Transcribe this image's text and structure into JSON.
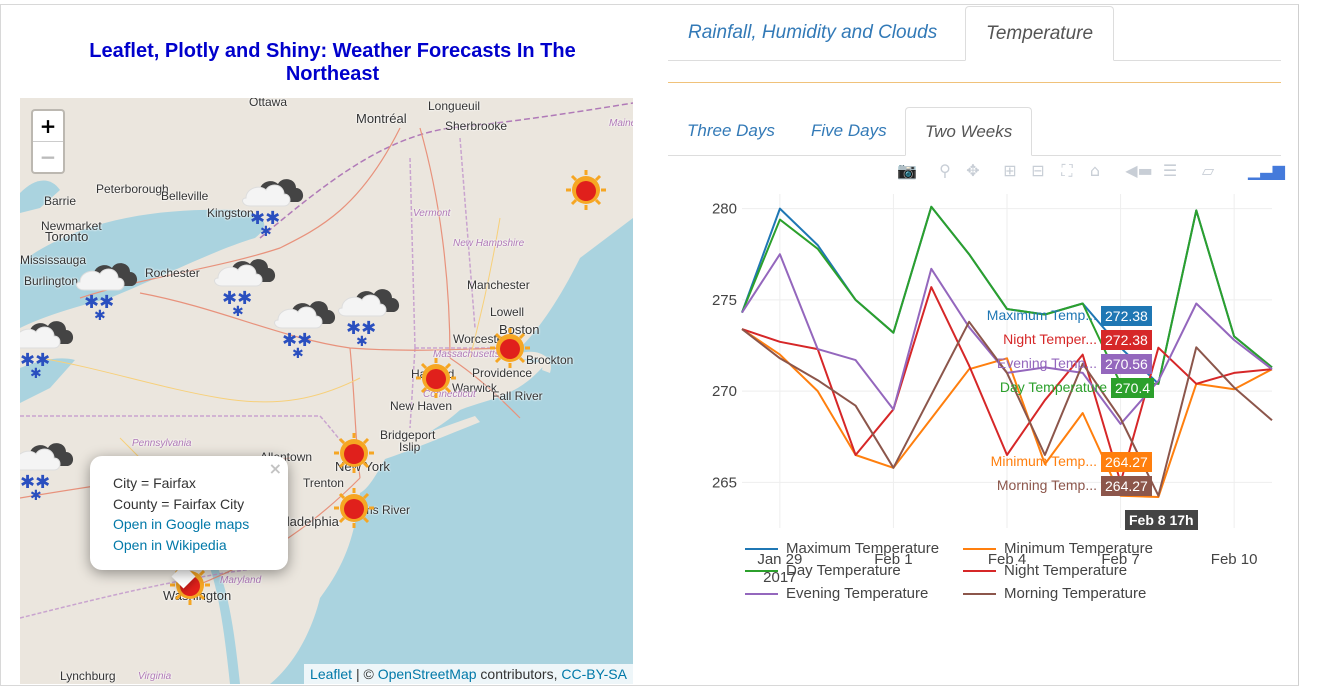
{
  "page": {
    "title": "Leaflet, Plotly and Shiny: Weather Forecasts In The Northeast"
  },
  "map": {
    "zoom_in": "+",
    "zoom_out": "−",
    "labels": [
      {
        "text": "Ottawa",
        "cls": "big"
      },
      {
        "text": "Longueuil",
        "cls": ""
      },
      {
        "text": "Montréal",
        "cls": "big"
      },
      {
        "text": "Sherbrooke",
        "cls": ""
      },
      {
        "text": "Maine",
        "cls": "state"
      },
      {
        "text": "Barrie",
        "cls": ""
      },
      {
        "text": "Peterborough",
        "cls": ""
      },
      {
        "text": "Belleville",
        "cls": ""
      },
      {
        "text": "Kingston",
        "cls": ""
      },
      {
        "text": "Vermont",
        "cls": "state"
      },
      {
        "text": "Newmarket",
        "cls": ""
      },
      {
        "text": "Toronto",
        "cls": "big"
      },
      {
        "text": "New Hampshire",
        "cls": "state"
      },
      {
        "text": "Mississauga",
        "cls": ""
      },
      {
        "text": "Rochester",
        "cls": ""
      },
      {
        "text": "Burlington",
        "cls": ""
      },
      {
        "text": "Manchester",
        "cls": ""
      },
      {
        "text": "Lowell",
        "cls": ""
      },
      {
        "text": "Worcester",
        "cls": ""
      },
      {
        "text": "Boston",
        "cls": "big"
      },
      {
        "text": "Massachusetts",
        "cls": "state"
      },
      {
        "text": "Brockton",
        "cls": ""
      },
      {
        "text": "Hartford",
        "cls": ""
      },
      {
        "text": "Providence",
        "cls": ""
      },
      {
        "text": "Warwick",
        "cls": ""
      },
      {
        "text": "Connecticut",
        "cls": "state"
      },
      {
        "text": "Fall River",
        "cls": ""
      },
      {
        "text": "New Haven",
        "cls": ""
      },
      {
        "text": "Bridgeport",
        "cls": ""
      },
      {
        "text": "Pennsylvania",
        "cls": "state"
      },
      {
        "text": "Allentown",
        "cls": ""
      },
      {
        "text": "Islip",
        "cls": ""
      },
      {
        "text": "New York",
        "cls": "big"
      },
      {
        "text": "Trenton",
        "cls": ""
      },
      {
        "text": "Toms River",
        "cls": ""
      },
      {
        "text": "Philadelphia",
        "cls": "big"
      },
      {
        "text": "Maryland",
        "cls": "state"
      },
      {
        "text": "Washington",
        "cls": "big"
      },
      {
        "text": "Lynchburg",
        "cls": ""
      },
      {
        "text": "Virginia",
        "cls": "state"
      }
    ],
    "popup": {
      "close": "×",
      "city": "City = Fairfax",
      "county": "County = Fairfax City",
      "link_maps": "Open in Google maps",
      "link_wiki": "Open in Wikipedia"
    },
    "attribution": {
      "leaflet": "Leaflet",
      "sep": " | © ",
      "osm": "OpenStreetMap",
      "contrib": " contributors, ",
      "license": "CC-BY-SA"
    }
  },
  "tabs": {
    "top": [
      {
        "label": "Rainfall, Humidity and Clouds",
        "active": false
      },
      {
        "label": "Temperature",
        "active": true
      }
    ],
    "sub": [
      {
        "label": "Three Days",
        "active": false
      },
      {
        "label": "Five Days",
        "active": false
      },
      {
        "label": "Two Weeks",
        "active": true
      }
    ]
  },
  "modebar": [
    "camera-icon",
    "zoom-icon",
    "pan-icon",
    "zoom-in-icon",
    "zoom-out-icon",
    "autoscale-icon",
    "reset-axes-icon",
    "hover-closest-icon",
    "hover-compare-icon",
    "toggle-spikelines-icon",
    "plotly-logo-icon"
  ],
  "chart_data": {
    "type": "line",
    "x": [
      "2017-01-28",
      "2017-01-29",
      "2017-01-30",
      "2017-01-31",
      "2017-02-01",
      "2017-02-02",
      "2017-02-03",
      "2017-02-04",
      "2017-02-05",
      "2017-02-06",
      "2017-02-07",
      "2017-02-08",
      "2017-02-09",
      "2017-02-10",
      "2017-02-11"
    ],
    "xticks": [
      "Jan 29\n2017",
      "Feb 1",
      "Feb 4",
      "Feb 7",
      "Feb 10"
    ],
    "yticks": [
      265,
      270,
      275,
      280
    ],
    "ylim": [
      262.5,
      280.8
    ],
    "series": [
      {
        "name": "Maximum Temperature",
        "color": "#1f77b4",
        "values": [
          274.3,
          280.0,
          278.0,
          275.0,
          273.2,
          280.1,
          277.5,
          274.5,
          274.2,
          274.8,
          272.38,
          270.4,
          279.9,
          273.0,
          271.3
        ]
      },
      {
        "name": "Minimum Temperature",
        "color": "#ff7f0e",
        "values": [
          273.4,
          272.0,
          270.0,
          266.5,
          265.8,
          268.5,
          271.2,
          271.8,
          266.0,
          268.8,
          264.27,
          264.2,
          270.4,
          270.1,
          271.2
        ]
      },
      {
        "name": "Day Temperature",
        "color": "#2ca02c",
        "values": [
          274.3,
          279.4,
          277.8,
          275.0,
          273.2,
          280.1,
          277.5,
          274.5,
          274.2,
          274.8,
          270.4,
          270.4,
          279.9,
          273.0,
          271.3
        ]
      },
      {
        "name": "Night Temperature",
        "color": "#d62728",
        "values": [
          273.4,
          272.7,
          272.3,
          266.5,
          269.0,
          275.7,
          271.4,
          266.5,
          269.5,
          272.0,
          265.0,
          272.38,
          270.4,
          271.0,
          271.2
        ]
      },
      {
        "name": "Evening Temperature",
        "color": "#9467bd",
        "values": [
          274.3,
          277.5,
          272.3,
          271.7,
          269.0,
          276.7,
          273.5,
          271.0,
          271.3,
          271.0,
          268.2,
          270.56,
          274.8,
          272.8,
          271.2
        ]
      },
      {
        "name": "Morning Temperature",
        "color": "#8c564b",
        "values": [
          273.4,
          271.8,
          270.6,
          269.2,
          265.8,
          269.8,
          273.8,
          271.0,
          266.5,
          271.5,
          268.5,
          264.27,
          272.4,
          270.2,
          268.4
        ]
      }
    ],
    "hover": {
      "x_label": "Feb 8 17h",
      "items": [
        {
          "name": "Maximum Temp...",
          "value": "272.38",
          "color": "#1f77b4"
        },
        {
          "name": "Night Temper...",
          "value": "272.38",
          "color": "#d62728"
        },
        {
          "name": "Evening Temp...",
          "value": "270.56",
          "color": "#9467bd"
        },
        {
          "name": "Day Temperature",
          "value": "270.4",
          "color": "#2ca02c"
        },
        {
          "name": "Minimum Temp...",
          "value": "264.27",
          "color": "#ff7f0e"
        },
        {
          "name": "Morning Temp...",
          "value": "264.27",
          "color": "#8c564b"
        }
      ]
    },
    "legend_placement": "bottom",
    "grid": true
  }
}
